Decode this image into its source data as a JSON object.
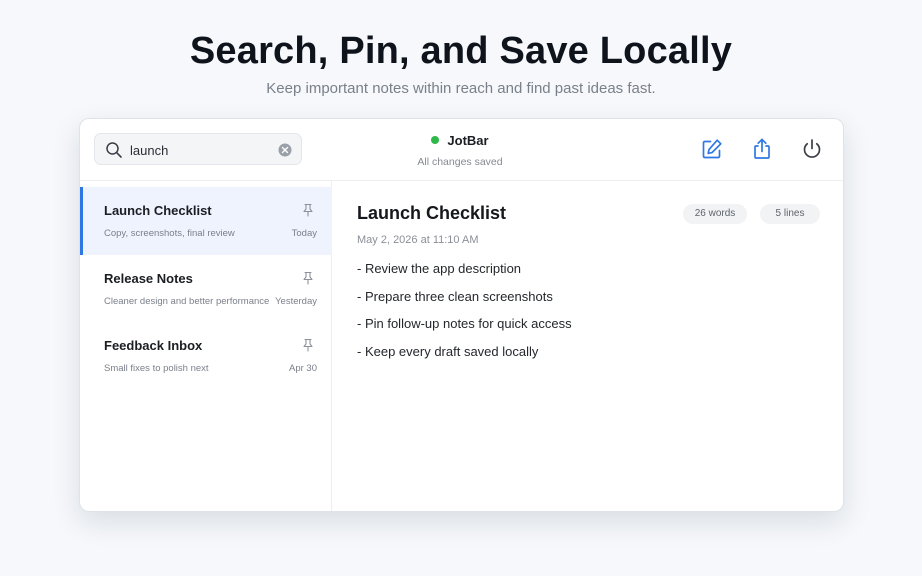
{
  "hero": {
    "title": "Search, Pin, and Save Locally",
    "subtitle": "Keep important notes within reach and find past ideas fast."
  },
  "toolbar": {
    "search": {
      "value": "launch",
      "icon": "search-icon",
      "clear_icon": "clear-icon"
    },
    "app_name": "JotBar",
    "status_text": "All changes saved",
    "status_color": "#2fb84a",
    "actions": [
      {
        "name": "new-note-button",
        "icon": "compose-icon"
      },
      {
        "name": "share-button",
        "icon": "share-icon"
      },
      {
        "name": "power-button",
        "icon": "power-icon"
      }
    ],
    "accent_color": "#2f78e4"
  },
  "sidebar": {
    "notes": [
      {
        "title": "Launch Checklist",
        "snippet": "Copy, screenshots, final review",
        "date": "Today",
        "pinned": true,
        "active": true
      },
      {
        "title": "Release Notes",
        "snippet": "Cleaner design and better performance",
        "date": "Yesterday",
        "pinned": true,
        "active": false
      },
      {
        "title": "Feedback Inbox",
        "snippet": "Small fixes to polish next",
        "date": "Apr 30",
        "pinned": true,
        "active": false
      }
    ]
  },
  "editor": {
    "title": "Launch Checklist",
    "timestamp": "May 2, 2026 at 11:10 AM",
    "word_count": "26 words",
    "line_count": "5 lines",
    "lines": [
      "- Review the app description",
      "- Prepare three clean screenshots",
      "- Pin follow-up notes for quick access",
      "- Keep every draft saved locally"
    ]
  }
}
